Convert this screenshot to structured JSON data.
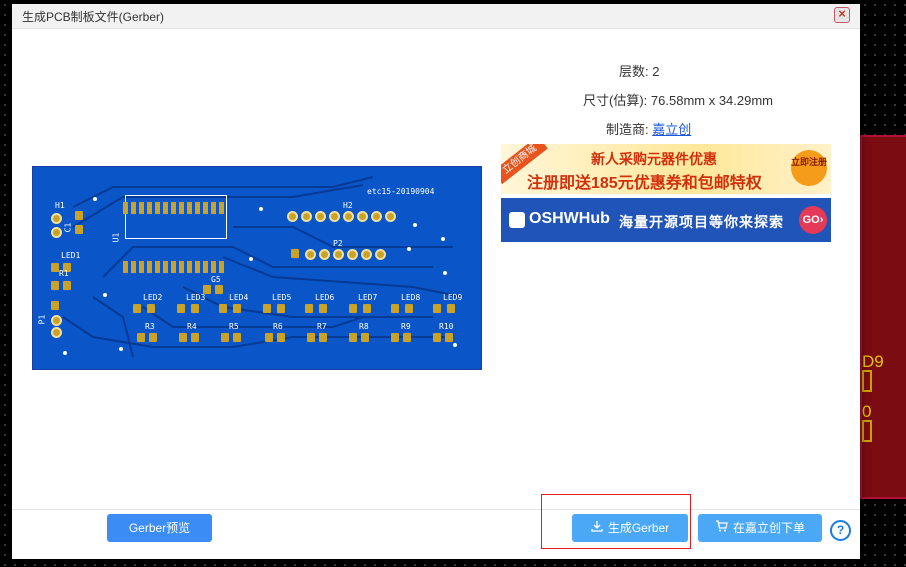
{
  "dialog": {
    "title": "生成PCB制板文件(Gerber)",
    "close_symbol": "×"
  },
  "info": {
    "layers_label": "层数:",
    "layers_value": "2",
    "size_label": "尺寸(估算):",
    "size_value": "76.58mm x 34.29mm",
    "maker_label": "制造商:",
    "maker_value": "嘉立创"
  },
  "pcb_preview": {
    "board_text": "etc15-20190904",
    "designators": [
      "H1",
      "C1",
      "U1",
      "LED1",
      "R1",
      "P1",
      "H2",
      "P2",
      "G5",
      "LED2",
      "LED3",
      "LED4",
      "LED5",
      "LED6",
      "LED7",
      "LED8",
      "LED9",
      "R3",
      "R4",
      "R5",
      "R6",
      "R7",
      "R8",
      "R9",
      "R10"
    ],
    "colors": {
      "board": "#0a55c8",
      "pad": "#c9a227",
      "silk": "#ffffff"
    }
  },
  "banners": {
    "szlcsc": {
      "ribbon": "立创商城",
      "line1": "新人采购元器件优惠",
      "line2": "注册即送185元优惠券和包邮特权",
      "cta": "立即注册"
    },
    "oshwhub": {
      "brand": "OSHWHub",
      "text": "海量开源项目等你来探索",
      "cta": "GO›"
    }
  },
  "footer": {
    "preview_button": "Gerber预览",
    "generate_button": "生成Gerber",
    "order_button": "在嘉立创下单",
    "help_symbol": "?"
  },
  "background": {
    "labels": [
      "D9",
      "0"
    ]
  },
  "icons": [
    "close-icon",
    "download-icon",
    "cart-icon",
    "help-icon"
  ]
}
